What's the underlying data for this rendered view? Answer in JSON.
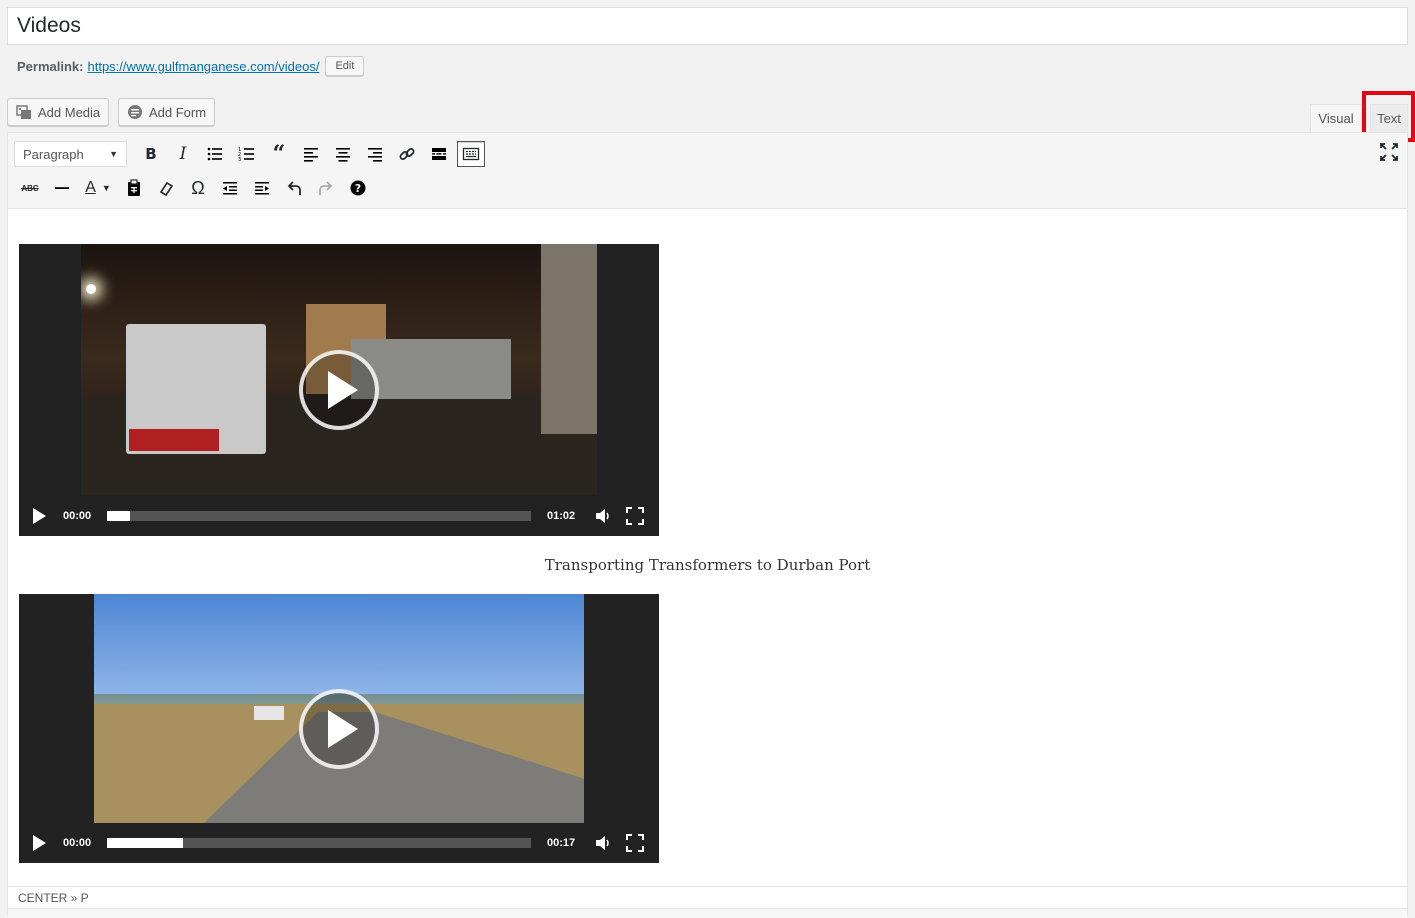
{
  "title": {
    "value": "Videos"
  },
  "permalink": {
    "label": "Permalink:",
    "url": "https://www.gulfmanganese.com/videos/",
    "edit_label": "Edit"
  },
  "media_buttons": {
    "add_media": "Add Media",
    "add_form": "Add Form"
  },
  "editor_tabs": {
    "visual": "Visual",
    "text": "Text"
  },
  "toolbar": {
    "format_select": "Paragraph",
    "row1_icons": [
      "bold-icon",
      "italic-icon",
      "bullet-list-icon",
      "numbered-list-icon",
      "blockquote-icon",
      "align-left-icon",
      "align-center-icon",
      "align-right-icon",
      "link-icon",
      "read-more-icon",
      "toolbar-toggle-icon"
    ],
    "row2_icons": [
      "strikethrough-icon",
      "horizontal-line-icon",
      "text-color-icon",
      "paste-text-icon",
      "clear-formatting-icon",
      "special-character-icon",
      "outdent-icon",
      "indent-icon",
      "undo-icon",
      "redo-icon",
      "help-icon"
    ]
  },
  "videos": [
    {
      "current_time": "00:00",
      "duration": "01:02",
      "progress": 0.055,
      "caption": "Transporting Transformers to Durban Port"
    },
    {
      "current_time": "00:00",
      "duration": "00:17",
      "progress": 0.18
    }
  ],
  "status_path": "CENTER » P",
  "colors": {
    "accent": "#0073aa",
    "highlight": "#e30613"
  }
}
